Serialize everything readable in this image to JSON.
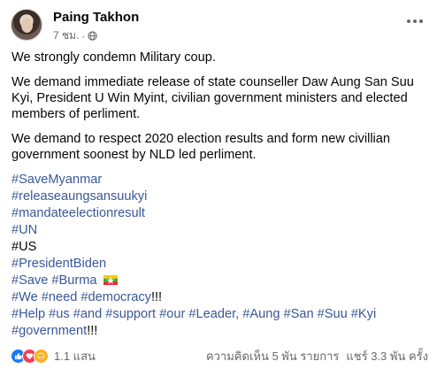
{
  "post": {
    "author": "Paing Takhon",
    "time": "7 ชม.",
    "separator": "·",
    "paragraphs": [
      "We strongly condemn Military coup.",
      "We demand immediate release of state counseller Daw Aung San Suu Kyi, President U Win Myint, civilian government ministers and elected members of perliment.",
      "We demand to respect 2020 election results and form new civillian government soonest by NLD led perliment."
    ],
    "hashtags": {
      "line1": "#SaveMyanmar",
      "line2": "#releaseaungsansuukyi",
      "line3": "#mandateelectionresult",
      "line4": "#UN",
      "line5": "#US",
      "line6": "#PresidentBiden",
      "line7": "#Save #Burma",
      "line8a": "#We #need #democracy",
      "line8b": "!!!",
      "line9": "#Help #us #and #support #our #Leader,  #Aung #San #Suu #Kyi",
      "line10a": "#government",
      "line10b": "!!!"
    }
  },
  "footer": {
    "reaction_count": "1.1 แสน",
    "comments": "ความคิดเห็น 5 พัน รายการ",
    "shares": "แชร์ 3.3 พัน ครั้ง"
  },
  "icons": {
    "globe": "globe-icon",
    "more": "more-options-icon",
    "flag": "myanmar-flag-icon",
    "reactions": [
      "like-icon",
      "love-icon",
      "care-icon"
    ]
  },
  "colors": {
    "link": "#385898",
    "text": "#050505",
    "muted": "#65676b",
    "like": "#1877f2",
    "love": "#f33e58",
    "care": "#f7b125"
  }
}
